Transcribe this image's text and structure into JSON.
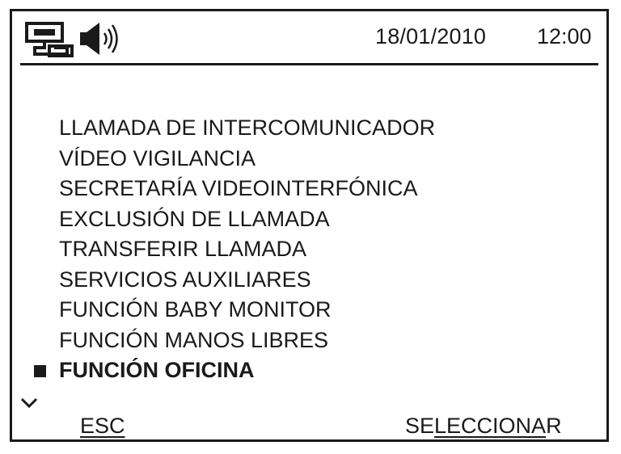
{
  "status_bar": {
    "date": "18/01/2010",
    "time": "12:00",
    "icons": [
      "network-icon",
      "speaker-icon"
    ]
  },
  "menu": {
    "items": [
      {
        "label": "LLAMADA DE INTERCOMUNICADOR",
        "selected": false
      },
      {
        "label": "VÍDEO VIGILANCIA",
        "selected": false
      },
      {
        "label": "SECRETARÍA VIDEOINTERFÓNICA",
        "selected": false
      },
      {
        "label": "EXCLUSIÓN DE LLAMADA",
        "selected": false
      },
      {
        "label": "TRANSFERIR LLAMADA",
        "selected": false
      },
      {
        "label": "SERVICIOS AUXILIARES",
        "selected": false
      },
      {
        "label": "FUNCIÓN BABY MONITOR",
        "selected": false
      },
      {
        "label": "FUNCIÓN MANOS LIBRES",
        "selected": false
      },
      {
        "label": "FUNCIÓN OFICINA",
        "selected": true
      }
    ],
    "scroll_icon": "chevron-down-icon"
  },
  "softkeys": {
    "left": {
      "label": "ESC"
    },
    "right": {
      "label_pre": "SE",
      "label_underlined": "LECCIONA",
      "label_post": "R"
    }
  },
  "colors": {
    "foreground": "#1a1a1a",
    "background": "#ffffff"
  }
}
